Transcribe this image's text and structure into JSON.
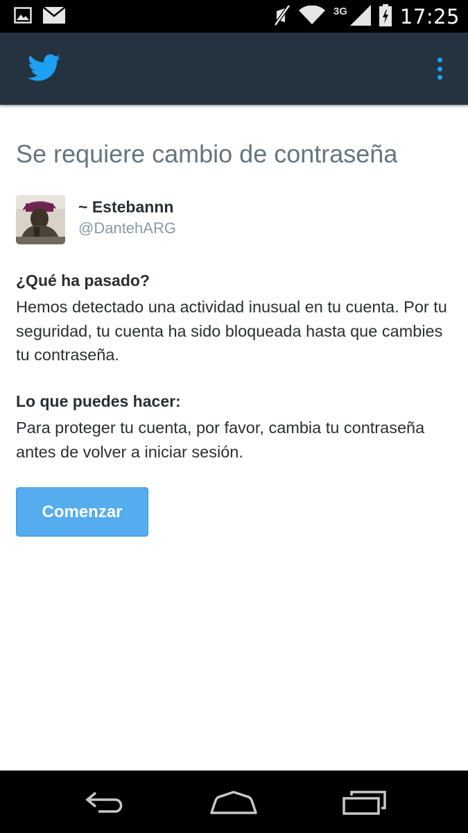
{
  "status_bar": {
    "network": "3G",
    "time": "17:25",
    "icons": [
      "image-notification-icon",
      "mail-notification-icon",
      "muted-icon",
      "wifi-icon",
      "signal-icon",
      "battery-icon"
    ]
  },
  "app_bar": {
    "logo": "twitter-bird-icon",
    "menu": "overflow-menu-icon",
    "background": "#253341",
    "accent": "#1da1f2"
  },
  "page": {
    "title": "Se requiere cambio de contraseña"
  },
  "user": {
    "display_name": "~ Estebannn",
    "handle": "@DantehARG"
  },
  "sections": [
    {
      "heading": "¿Qué ha pasado?",
      "body": "Hemos detectado una actividad inusual en tu cuenta. Por tu seguridad, tu cuenta ha sido bloqueada hasta que cambies tu contraseña."
    },
    {
      "heading": "Lo que puedes hacer:",
      "body": "Para proteger tu cuenta, por favor, cambia tu contraseña antes de volver a iniciar sesión."
    }
  ],
  "cta": {
    "label": "Comenzar",
    "color": "#55acee"
  },
  "nav_bar": {
    "icons": [
      "back-icon",
      "home-icon",
      "recent-apps-icon"
    ]
  }
}
